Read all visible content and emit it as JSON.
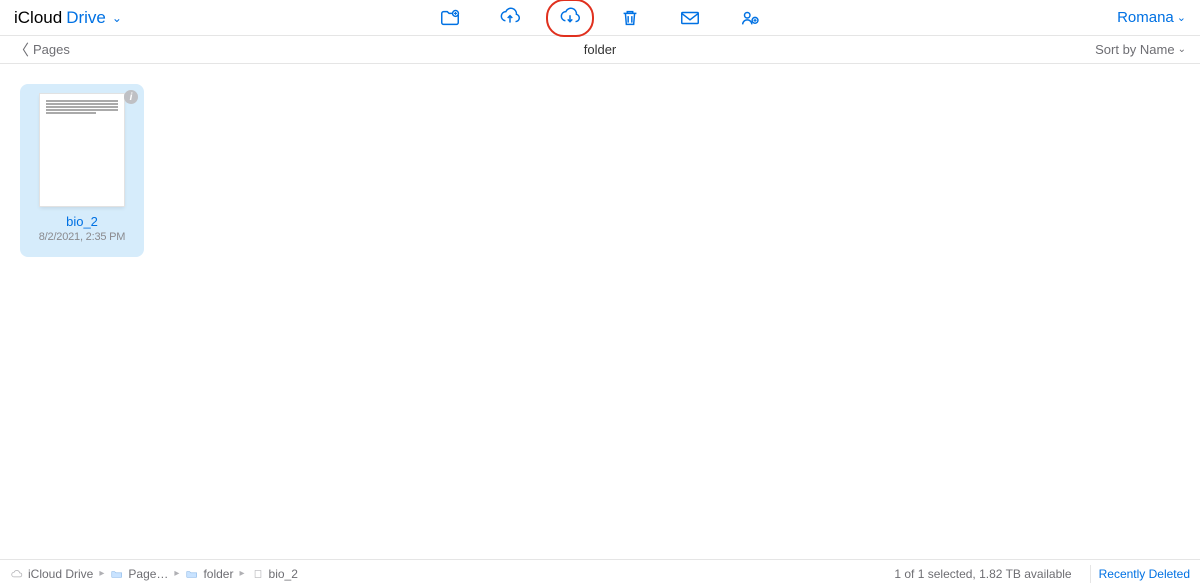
{
  "app": {
    "title_black": "iCloud",
    "title_blue": "Drive"
  },
  "user": {
    "name": "Romana"
  },
  "locbar": {
    "back_label": "Pages",
    "folder_name": "folder",
    "sort_label": "Sort by Name"
  },
  "file": {
    "name": "bio_2",
    "date": "8/2/2021, 2:35 PM"
  },
  "bottom": {
    "crumbs": [
      "iCloud Drive",
      "Page…",
      "folder",
      "bio_2"
    ],
    "status": "1 of 1 selected, 1.82 TB available",
    "deleted": "Recently Deleted"
  }
}
